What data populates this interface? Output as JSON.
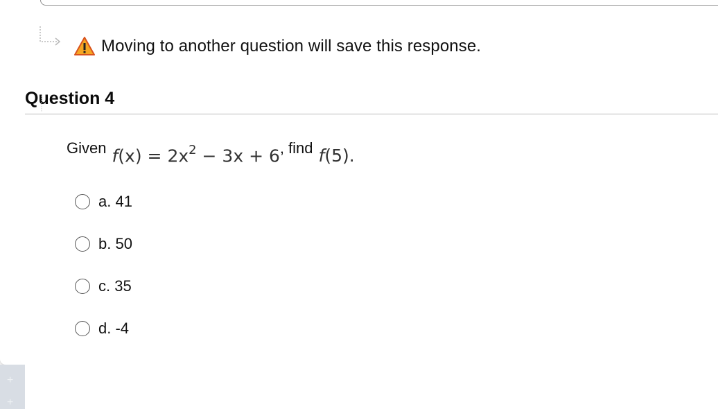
{
  "notice": {
    "text": "Moving to another question will save this response."
  },
  "question": {
    "title": "Question 4",
    "prefix": "Given",
    "expression_fn": "f",
    "expression_lhs_tail": "(x) = 2x",
    "expression_exp": "2",
    "expression_rhs": " − 3x + 6",
    "separator": ",",
    "mid_word": "find",
    "target_fn": "f",
    "target_tail": "(5)."
  },
  "options": [
    {
      "label": "a. 41",
      "selected": false
    },
    {
      "label": "b. 50",
      "selected": false
    },
    {
      "label": "c. 35",
      "selected": false
    },
    {
      "label": "d. -4",
      "selected": false
    }
  ],
  "colors": {
    "warning_fill": "#f5a623",
    "warning_stroke": "#d9531e",
    "divider": "#b9b9b9"
  },
  "icons": {
    "notice_arrow": "dotted-arrow-icon",
    "warning": "warning-icon"
  }
}
